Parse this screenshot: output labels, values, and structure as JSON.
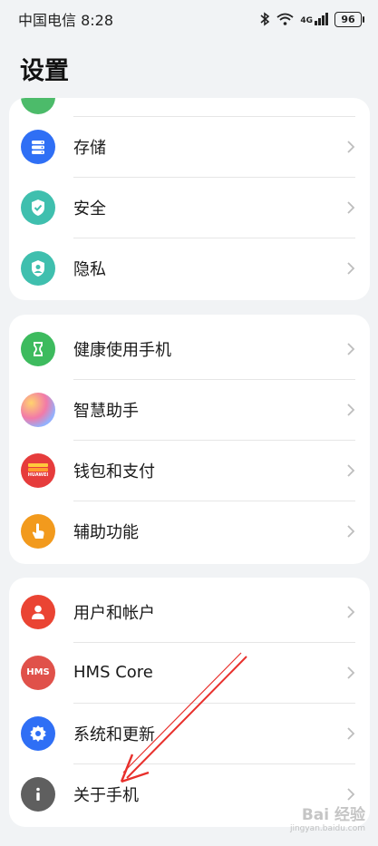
{
  "status_bar": {
    "carrier_time": "中国电信 8:28",
    "signal_label": "4G",
    "battery": "96"
  },
  "page": {
    "title": "设置"
  },
  "groups": [
    {
      "items": [
        {
          "label": "存储",
          "icon": "storage-icon",
          "color": "#2f6ff5"
        },
        {
          "label": "安全",
          "icon": "shield-check-icon",
          "color": "#3fbfae"
        },
        {
          "label": "隐私",
          "icon": "privacy-shield-icon",
          "color": "#3fbfae"
        }
      ]
    },
    {
      "items": [
        {
          "label": "健康使用手机",
          "icon": "hourglass-icon",
          "color": "#3dbb5e"
        },
        {
          "label": "智慧助手",
          "icon": "smart-assistant-icon",
          "color": "#c77ee6"
        },
        {
          "label": "钱包和支付",
          "icon": "wallet-icon",
          "color": "#e63c3c"
        },
        {
          "label": "辅助功能",
          "icon": "hand-pointer-icon",
          "color": "#f29a1d"
        }
      ]
    },
    {
      "items": [
        {
          "label": "用户和帐户",
          "icon": "user-icon",
          "color": "#ea4433"
        },
        {
          "label": "HMS Core",
          "icon": "hms-icon",
          "color": "#e0514a"
        },
        {
          "label": "系统和更新",
          "icon": "system-gear-icon",
          "color": "#2f6ff5"
        },
        {
          "label": "关于手机",
          "icon": "info-icon",
          "color": "#5f5f5f"
        }
      ]
    }
  ],
  "wallet_icon_text": "HUAWEI",
  "hms_icon_text": "HMS",
  "watermark": {
    "title": "Bai 经验",
    "sub": "jingyan.baidu.com"
  }
}
